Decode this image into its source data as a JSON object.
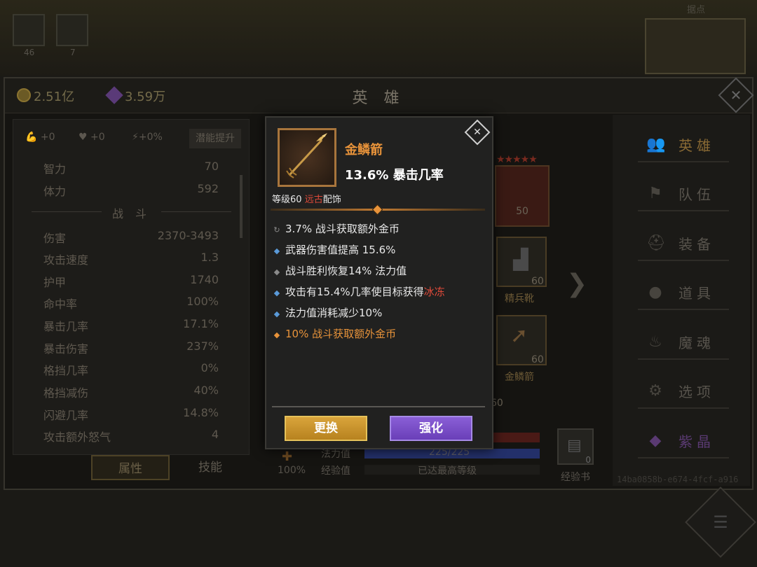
{
  "topbar": {
    "slot1_count": "46",
    "slot2_count": "7",
    "minimap_label": "据点"
  },
  "header": {
    "gold": "2.51亿",
    "gems": "3.59万",
    "title": "英 雄",
    "close_glyph": "✕"
  },
  "left_panel": {
    "buffs": {
      "strength": "+0",
      "health": "+0",
      "speed": "+0%"
    },
    "potential_button": "潜能提升",
    "stats_top": [
      {
        "label": "智力",
        "value": "70"
      },
      {
        "label": "体力",
        "value": "592"
      }
    ],
    "section_title": "战 斗",
    "stats_combat": [
      {
        "label": "伤害",
        "value": "2370-3493"
      },
      {
        "label": "攻击速度",
        "value": "1.3"
      },
      {
        "label": "护甲",
        "value": "1740"
      },
      {
        "label": "命中率",
        "value": "100%"
      },
      {
        "label": "暴击几率",
        "value": "17.1%"
      },
      {
        "label": "暴击伤害",
        "value": "237%"
      },
      {
        "label": "格挡几率",
        "value": "0%"
      },
      {
        "label": "格挡减伤",
        "value": "40%"
      },
      {
        "label": "闪避几率",
        "value": "14.8%"
      },
      {
        "label": "攻击额外怒气",
        "value": "4"
      }
    ],
    "tabs": {
      "attributes": "属性",
      "skills": "技能"
    }
  },
  "center": {
    "hero_level": "50",
    "stars": "★★★★★",
    "boots": {
      "level": "60",
      "name": "精兵靴"
    },
    "arrow_slot": {
      "level": "60",
      "name": "金鳞箭"
    },
    "partial_level": "60",
    "mana_label": "法力值",
    "mana_value": "225/225",
    "exp_label": "经验值",
    "exp_value": "已达最高等级",
    "percent": "100%",
    "exp_book": {
      "count": "0",
      "label": "经验书"
    }
  },
  "nav": {
    "items": [
      {
        "label": "英雄",
        "icon": "hero-icon"
      },
      {
        "label": "队伍",
        "icon": "flag-icon"
      },
      {
        "label": "装备",
        "icon": "helmet-icon"
      },
      {
        "label": "道具",
        "icon": "bag-icon"
      },
      {
        "label": "魔魂",
        "icon": "flame-icon"
      },
      {
        "label": "选项",
        "icon": "gear-icon"
      },
      {
        "label": "紫晶",
        "icon": "crystal-icon"
      }
    ],
    "uuid": "14ba0858b-e674-4fcf-a916"
  },
  "popup": {
    "item_name": "金鳞箭",
    "item_main_stat": "13.6% 暴击几率",
    "meta_prefix": "等级60 ",
    "meta_rarity": "远古",
    "meta_suffix": "配饰",
    "affixes": [
      {
        "bullet": "↻",
        "text": "3.7% 战斗获取额外金币"
      },
      {
        "bullet": "◆",
        "text": "武器伤害值提高 15.6%"
      },
      {
        "bullet": "◆",
        "text": "战斗胜利恢复14% 法力值"
      },
      {
        "bullet": "◆",
        "text_pre": "攻击有15.4%几率使目标获得",
        "text_hl": "冰冻"
      },
      {
        "bullet": "◆",
        "text": "法力值消耗减少10%"
      },
      {
        "bullet": "◆",
        "text": "10% 战斗获取额外金币"
      }
    ],
    "close_glyph": "✕",
    "btn_replace": "更换",
    "btn_upgrade": "强化"
  },
  "colors": {
    "accent_orange": "#e8933a",
    "ancient_red": "#e04a3a",
    "affix_blue": "#5a9ad8",
    "replace_gold": "#d9a43b",
    "upgrade_purple": "#8a5fd6"
  }
}
